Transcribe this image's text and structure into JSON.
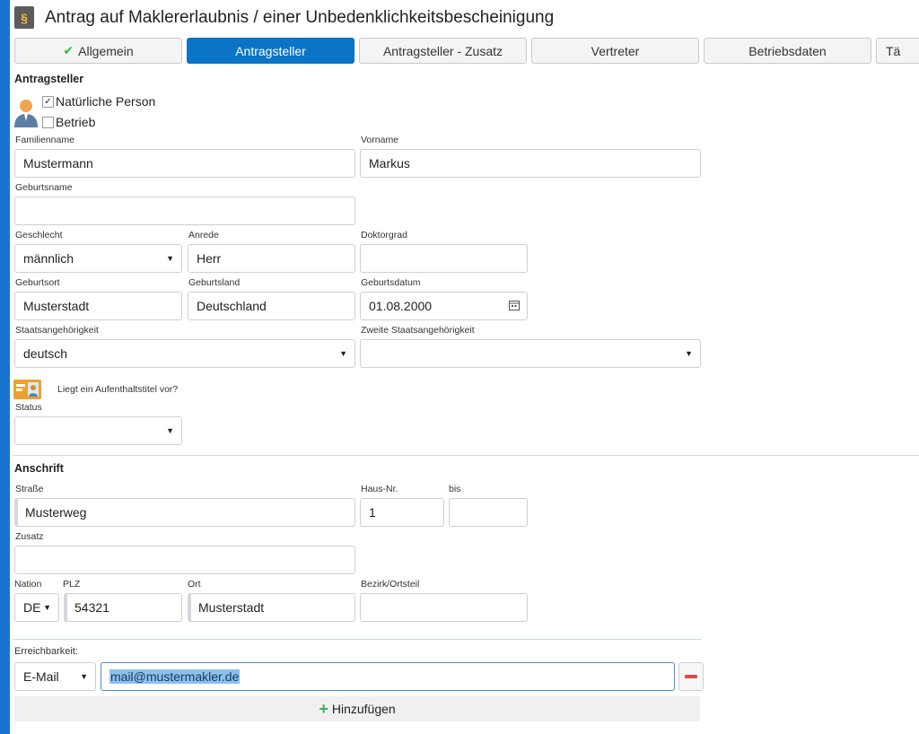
{
  "window": {
    "title": "Antrag auf Maklererlaubnis / einer Unbedenklichkeitsbescheinigung"
  },
  "tabs": [
    {
      "label": "Allgemein"
    },
    {
      "label": "Antragsteller"
    },
    {
      "label": "Antragsteller - Zusatz"
    },
    {
      "label": "Vertreter"
    },
    {
      "label": "Betriebsdaten"
    },
    {
      "label": "Tä"
    }
  ],
  "applicant": {
    "heading": "Antragsteller",
    "natural_person": "Natürliche Person",
    "natural_person_check": "✓",
    "business": "Betrieb",
    "lastname_label": "Familienname",
    "lastname": "Mustermann",
    "firstname_label": "Vorname",
    "firstname": "Markus",
    "birthname_label": "Geburtsname",
    "birthname": "",
    "gender_label": "Geschlecht",
    "gender": "männlich",
    "salutation_label": "Anrede",
    "salutation": "Herr",
    "doctor_label": "Doktorgrad",
    "doctor": "",
    "birthplace_label": "Geburtsort",
    "birthplace": "Musterstadt",
    "birthcountry_label": "Geburtsland",
    "birthcountry": "Deutschland",
    "birthdate_label": "Geburtsdatum",
    "birthdate": "01.08.2000",
    "nationality_label": "Staatsangehörigkeit",
    "nationality": "deutsch",
    "second_nationality_label": "Zweite Staatsangehörigkeit",
    "second_nationality": "",
    "residence_hint": "Liegt ein Aufenthaltstitel vor?",
    "status_label": "Status",
    "status": ""
  },
  "address": {
    "heading": "Anschrift",
    "street_label": "Straße",
    "street": "Musterweg",
    "houseno_label": "Haus-Nr.",
    "houseno": "1",
    "to_label": "bis",
    "to": "",
    "extra_label": "Zusatz",
    "extra": "",
    "nation_label": "Nation",
    "nation": "DE",
    "zip_label": "PLZ",
    "zip": "54321",
    "city_label": "Ort",
    "city": "Musterstadt",
    "district_label": "Bezirk/Ortsteil",
    "district": ""
  },
  "contact": {
    "heading": "Erreichbarkeit:",
    "type": "E-Mail",
    "value": "mail@mustermakler.de",
    "add_label": "Hinzufügen"
  },
  "colors": {
    "accent": "#0a74c6",
    "check": "#3bb54a",
    "remove": "#e14a4a"
  }
}
